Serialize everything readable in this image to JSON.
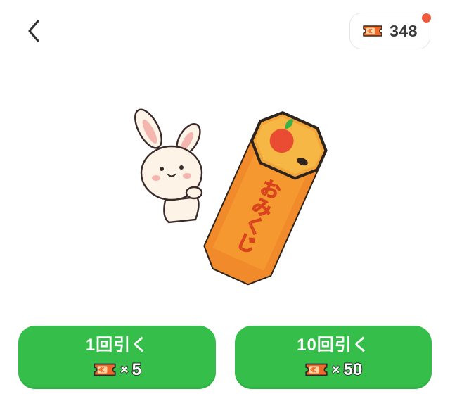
{
  "header": {
    "back_icon": "chevron-left-icon",
    "ticket_icon": "ticket-icon",
    "ticket_count": "348",
    "notification_color": "#ef5a3c"
  },
  "hero": {
    "character": "rabbit",
    "object": "omikuji-box",
    "object_label": "おみくじ"
  },
  "buttons": [
    {
      "label": "1回引く",
      "cost_prefix": "×",
      "cost": "5"
    },
    {
      "label": "10回引く",
      "cost_prefix": "×",
      "cost": "50"
    }
  ],
  "colors": {
    "button_green": "#35be49",
    "box_orange": "#f2a63a",
    "box_dark_orange": "#e8741f"
  }
}
